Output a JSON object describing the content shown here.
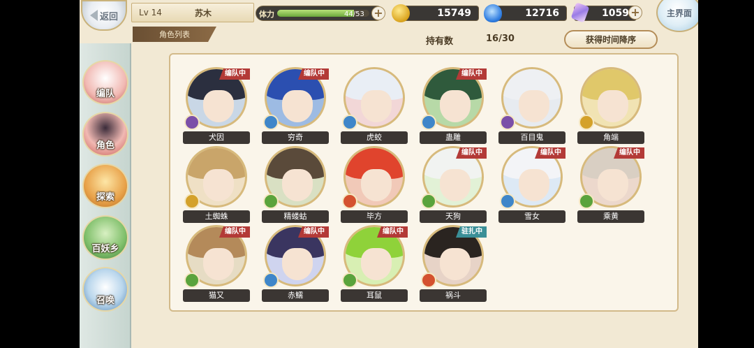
{
  "hud": {
    "back_label": "返回",
    "level": "Lv 14",
    "player_name": "苏木",
    "list_title": "角色列表",
    "stamina_label": "体力",
    "stamina_value": "44/53",
    "stamina_fraction": 0.83,
    "gold": "15749",
    "spirit": "12716",
    "crystal": "1059",
    "home_label": "主界面",
    "plus_symbol": "+"
  },
  "sidebar": {
    "items": [
      {
        "label": "编队"
      },
      {
        "label": "角色"
      },
      {
        "label": "探索"
      },
      {
        "label": "百妖乡"
      },
      {
        "label": "召唤"
      }
    ]
  },
  "list": {
    "owned_label": "持有数",
    "owned_value": "16/30",
    "sort_label": "获得时间降序"
  },
  "characters": [
    {
      "name": "犬因",
      "badge": "编队中",
      "element": "purple"
    },
    {
      "name": "穷奇",
      "badge": "编队中",
      "element": "blue"
    },
    {
      "name": "虎蛟",
      "badge": "",
      "element": "blue"
    },
    {
      "name": "蛊雕",
      "badge": "编队中",
      "element": "blue"
    },
    {
      "name": "百目鬼",
      "badge": "",
      "element": "purple"
    },
    {
      "name": "角端",
      "badge": "",
      "element": "gold"
    },
    {
      "name": "土蜘蛛",
      "badge": "",
      "element": "gold"
    },
    {
      "name": "精蝼蛄",
      "badge": "",
      "element": "green"
    },
    {
      "name": "毕方",
      "badge": "",
      "element": "red"
    },
    {
      "name": "天狗",
      "badge": "编队中",
      "element": "green"
    },
    {
      "name": "雪女",
      "badge": "编队中",
      "element": "blue"
    },
    {
      "name": "乘黄",
      "badge": "编队中",
      "element": "green"
    },
    {
      "name": "猫又",
      "badge": "编队中",
      "element": "green"
    },
    {
      "name": "赤鱬",
      "badge": "编队中",
      "element": "blue"
    },
    {
      "name": "耳鼠",
      "badge": "编队中",
      "element": "green"
    },
    {
      "name": "祸斗",
      "badge": "驻扎中",
      "element": "red"
    }
  ],
  "colors": {
    "badge_team": "#b33a37",
    "badge_station": "#3a8f97",
    "purple": "#7b4fa8",
    "blue": "#3f86c9",
    "gold": "#d4a12a",
    "green": "#5aa33c",
    "red": "#d4512f"
  }
}
